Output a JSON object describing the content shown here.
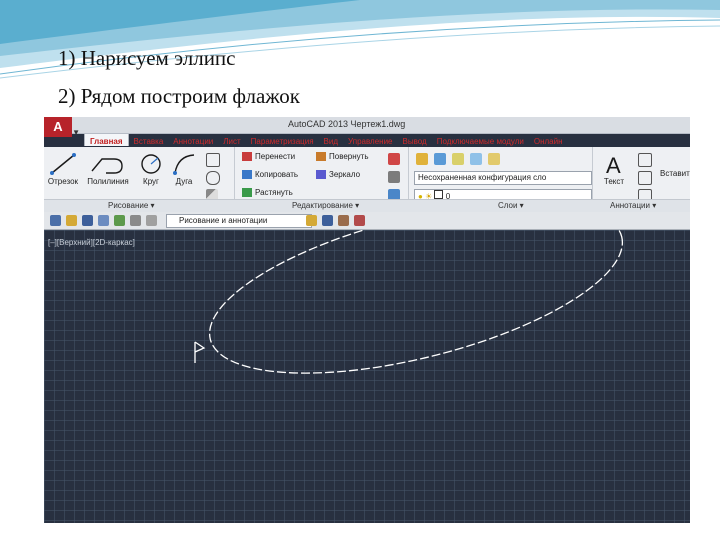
{
  "slide": {
    "task1": "1) Нарисуем эллипс",
    "task2": "2) Рядом построим флажок"
  },
  "app": {
    "logo": "A",
    "title": "AutoCAD 2013  Чертеж1.dwg",
    "tabs": [
      "Главная",
      "Вставка",
      "Аннотации",
      "Лист",
      "Параметризация",
      "Вид",
      "Управление",
      "Вывод",
      "Подключаемые модули",
      "Онлайн"
    ]
  },
  "ribbon": {
    "draw_tools": [
      "Отрезок",
      "Полилиния",
      "Круг",
      "Дуга"
    ],
    "modify_tools": [
      "Перенести",
      "Копировать",
      "Растянуть",
      "Повернуть",
      "Зеркало"
    ],
    "layer_combo": "Несохраненная конфигурация сло",
    "layer_value": "0",
    "text_tool": "Текст",
    "text_tool_2": "Вставить",
    "panels": {
      "draw": "Рисование",
      "modify": "Редактирование",
      "layers": "Слои",
      "annotation": "Аннотации"
    }
  },
  "qat": {
    "workspace": "Рисование и аннотации"
  },
  "viewport": {
    "label": "[–][Верхний][2D-каркас]"
  },
  "colors": {
    "canvas_bg": "#283040",
    "grid": "#46546a",
    "ribbon_bg": "#eef0f3",
    "tab_text": "#d12b2b",
    "app_red": "#b7232a",
    "geometry": "#ffffff"
  }
}
